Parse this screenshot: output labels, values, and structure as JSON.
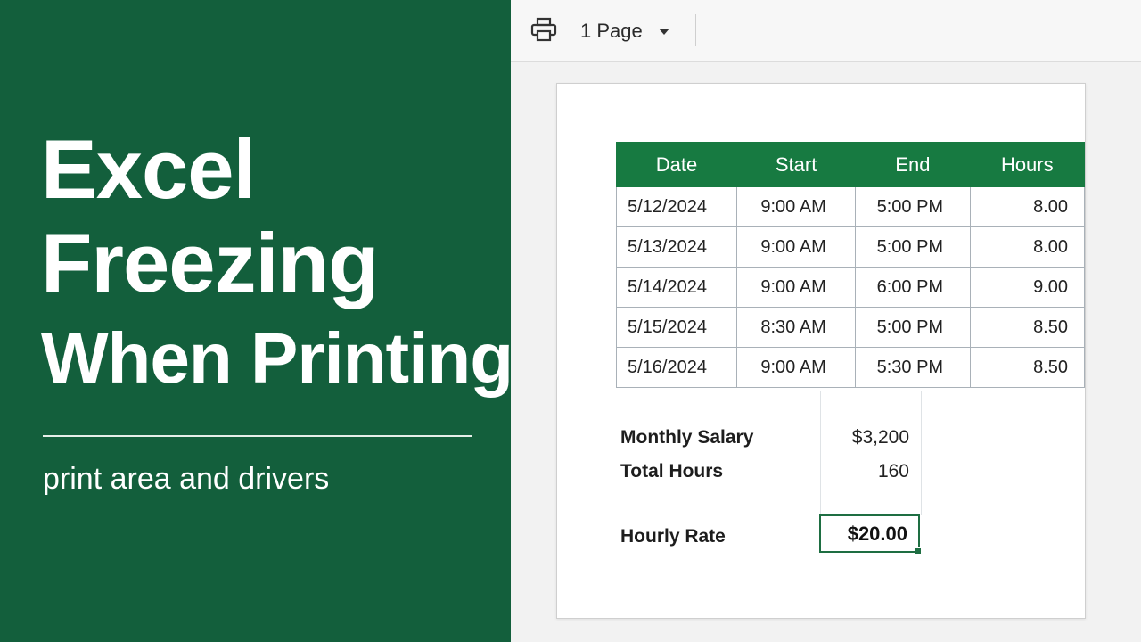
{
  "banner": {
    "title_lines": [
      "Excel",
      "Freezing",
      "When Printing"
    ],
    "subtitle": "print area and drivers",
    "background": "#135f3c"
  },
  "toolbar": {
    "print_icon": "printer-icon",
    "page_select": "1 Page",
    "dropdown_icon": "caret-down-icon"
  },
  "sheet": {
    "headers": [
      "Date",
      "Start",
      "End",
      "Hours"
    ],
    "rows": [
      [
        "5/12/2024",
        "9:00 AM",
        "5:00 PM",
        "8.00"
      ],
      [
        "5/13/2024",
        "9:00 AM",
        "5:00 PM",
        "8.00"
      ],
      [
        "5/14/2024",
        "9:00 AM",
        "6:00 PM",
        "9.00"
      ],
      [
        "5/15/2024",
        "8:30 AM",
        "5:00 PM",
        "8.50"
      ],
      [
        "5/16/2024",
        "9:00 AM",
        "5:30 PM",
        "8.50"
      ]
    ],
    "header_color": "#177a41"
  },
  "summary": {
    "monthly_salary_label": "Monthly Salary",
    "monthly_salary_value": "$3,200",
    "total_hours_label": "Total Hours",
    "total_hours_value": "160",
    "hourly_rate_label": "Hourly Rate",
    "hourly_rate_value": "$20.00"
  }
}
